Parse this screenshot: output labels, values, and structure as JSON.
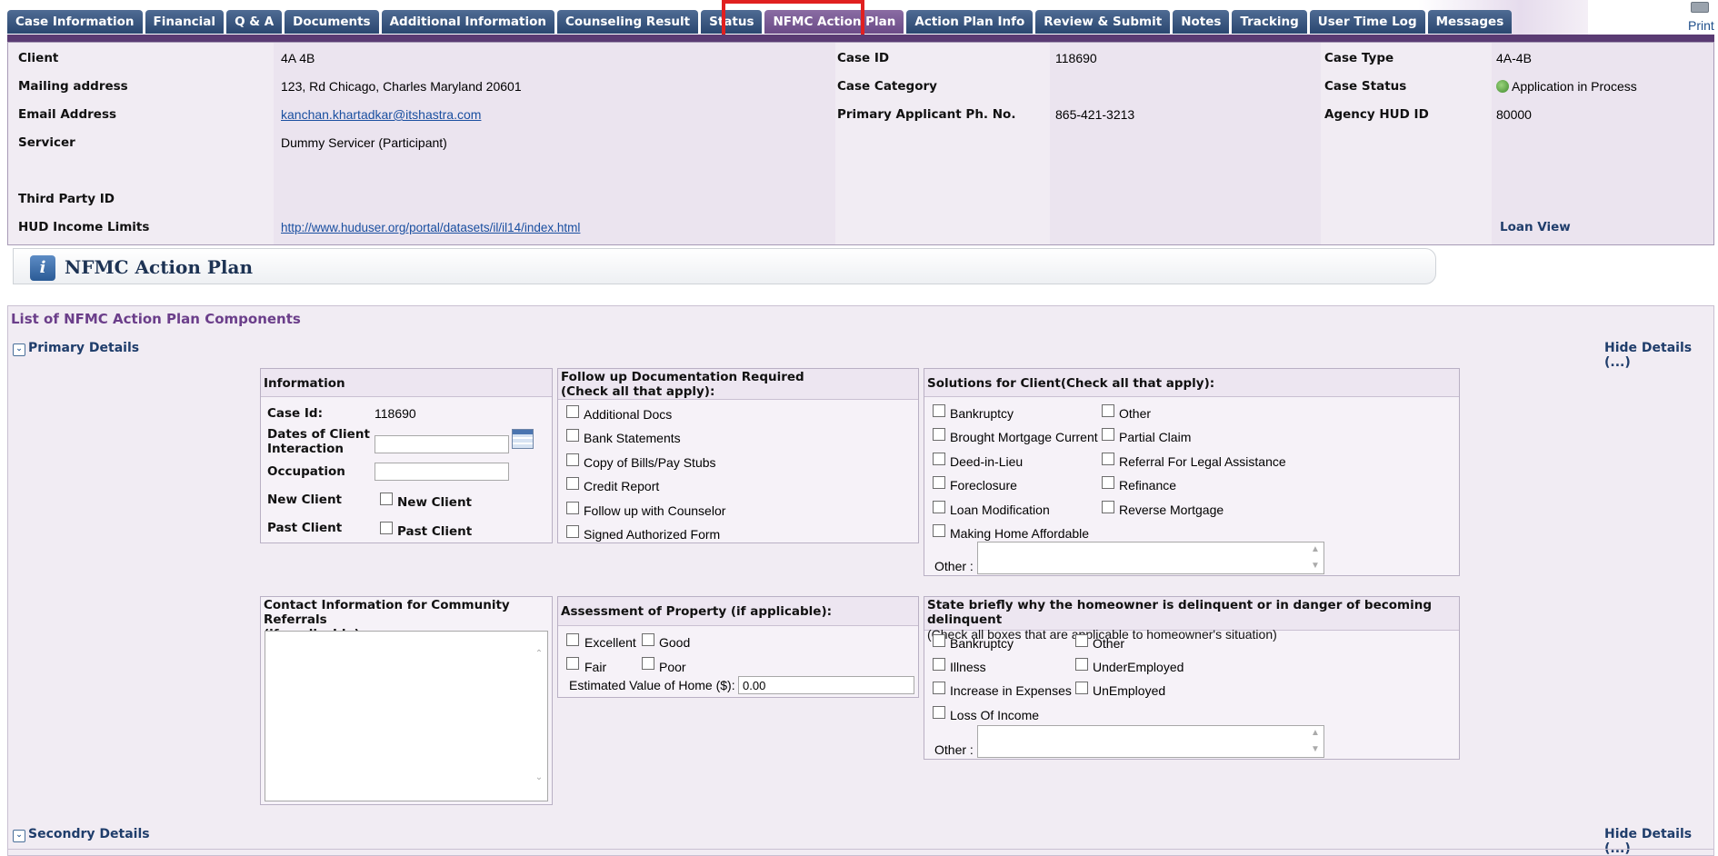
{
  "tabs": [
    {
      "label": "Case Information",
      "active": false
    },
    {
      "label": "Financial",
      "active": false
    },
    {
      "label": "Q & A",
      "active": false
    },
    {
      "label": "Documents",
      "active": false
    },
    {
      "label": "Additional Information",
      "active": false
    },
    {
      "label": "Counseling Result",
      "active": false
    },
    {
      "label": "Status",
      "active": false
    },
    {
      "label": "NFMC Action Plan",
      "active": true
    },
    {
      "label": "Action Plan Info",
      "active": false
    },
    {
      "label": "Review & Submit",
      "active": false
    },
    {
      "label": "Notes",
      "active": false
    },
    {
      "label": "Tracking",
      "active": false
    },
    {
      "label": "User Time Log",
      "active": false
    },
    {
      "label": "Messages",
      "active": false
    }
  ],
  "print_label": "Print",
  "case_info": {
    "client_label": "Client",
    "client": "4A 4B",
    "case_id_label": "Case ID",
    "case_id": "118690",
    "case_type_label": "Case Type",
    "case_type": "4A-4B",
    "mailing_label": "Mailing address",
    "mailing": "123, Rd  Chicago, Charles Maryland 20601",
    "case_category_label": "Case Category",
    "case_category": "",
    "case_status_label": "Case Status",
    "case_status": "Application in Process",
    "email_label": "Email Address",
    "email": "kanchan.khartadkar@itshastra.com",
    "primary_phone_label": "Primary Applicant Ph. No.",
    "primary_phone": "865-421-3213",
    "agency_hud_label": "Agency HUD ID",
    "agency_hud": "80000",
    "servicer_label": "Servicer",
    "servicer": "Dummy Servicer (Participant)",
    "third_party_label": "Third Party ID",
    "third_party": "",
    "hud_income_label": "HUD Income Limits",
    "hud_income_link": "http://www.huduser.org/portal/datasets/il/il14/index.html",
    "loan_view": "Loan View"
  },
  "section_title": "NFMC Action Plan",
  "list_title": "List of NFMC Action Plan Components",
  "primary_details": "Primary Details",
  "secondary_details": "Secondry Details",
  "hide_details": "Hide Details (...)",
  "information": {
    "title": "Information",
    "case_id_label": "Case Id:",
    "case_id": "118690",
    "dates_label_1": "Dates of Client",
    "dates_label_2": "Interaction",
    "dates_value": "",
    "occupation_label": "Occupation",
    "occupation_value": "",
    "new_client_label": "New Client",
    "new_client_cb": "New Client",
    "past_client_label": "Past Client",
    "past_client_cb": "Past Client"
  },
  "followup": {
    "title_1": "Follow up Documentation Required",
    "title_2": "(Check all that apply):",
    "items": [
      "Additional Docs",
      "Bank Statements",
      "Copy of Bills/Pay Stubs",
      "Credit Report",
      "Follow up with Counselor",
      "Signed Authorized Form"
    ]
  },
  "solutions": {
    "title": "Solutions for Client(Check all that apply):",
    "left": [
      "Bankruptcy",
      "Brought Mortgage Current",
      "Deed-in-Lieu",
      "Foreclosure",
      "Loan Modification",
      "Making Home Affordable"
    ],
    "right": [
      "Other",
      "Partial Claim",
      "Referral For Legal Assistance",
      "Refinance",
      "Reverse Mortgage"
    ],
    "other_label": "Other :"
  },
  "contact": {
    "title_1": "Contact Information for Community Referrals",
    "title_2": "(if applicable)"
  },
  "assessment": {
    "title": "Assessment of Property (if applicable):",
    "excellent": "Excellent",
    "good": "Good",
    "fair": "Fair",
    "poor": "Poor",
    "estimated_label": "Estimated Value of Home ($):",
    "estimated_value": "0.00"
  },
  "delinquent": {
    "title": "State briefly why the homeowner is delinquent or in danger of becoming delinquent",
    "subtitle": "(Check all boxes that are applicable to homeowner's situation)",
    "left": [
      "Bankruptcy",
      "Illness",
      "Increase in Expenses",
      "Loss Of Income"
    ],
    "right": [
      "Other",
      "UnderEmployed",
      "UnEmployed"
    ],
    "other_label": "Other :"
  },
  "colors": {
    "tab": "#2a4770",
    "tab_active": "#6b4b87",
    "band": "#5a3b73",
    "link": "#1a4fa0",
    "highlight": "#e02020"
  }
}
